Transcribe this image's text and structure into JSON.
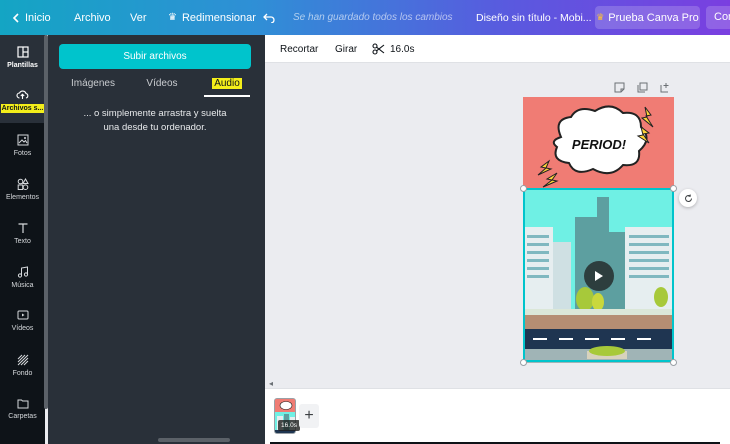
{
  "topbar": {
    "home": "Inicio",
    "file": "Archivo",
    "view": "Ver",
    "resize": "Redimensionar",
    "saved_status": "Se han guardado todos los cambios",
    "doc_title": "Diseño sin título - Mobi...",
    "pro": "Prueba Canva Pro",
    "share": "Compartir"
  },
  "rail": {
    "items": [
      {
        "label": "Plantillas",
        "icon": "templates-icon"
      },
      {
        "label": "Archivos s...",
        "icon": "upload-cloud-icon"
      },
      {
        "label": "Fotos",
        "icon": "photo-icon"
      },
      {
        "label": "Elementos",
        "icon": "shapes-icon"
      },
      {
        "label": "Texto",
        "icon": "text-icon"
      },
      {
        "label": "Música",
        "icon": "music-icon"
      },
      {
        "label": "Vídeos",
        "icon": "video-icon"
      },
      {
        "label": "Fondo",
        "icon": "background-icon"
      },
      {
        "label": "Carpetas",
        "icon": "folder-icon"
      }
    ]
  },
  "panel": {
    "upload_button": "Subir archivos",
    "tabs": [
      "Imágenes",
      "Vídeos",
      "Audio"
    ],
    "active_tab": "Audio",
    "drop_line1": "... o simplemente arrastra y suelta",
    "drop_line2": "una desde tu ordenador."
  },
  "toolbar": {
    "crop": "Recortar",
    "flip": "Girar",
    "duration": "16.0s"
  },
  "canvas": {
    "sticker_text": "PERIOD!"
  },
  "timeline": {
    "page_duration": "16.0s",
    "add_label": "+"
  },
  "colors": {
    "accent": "#00c4cc",
    "highlight": "#f3ee1a",
    "sticker_bg": "#f07c74"
  }
}
